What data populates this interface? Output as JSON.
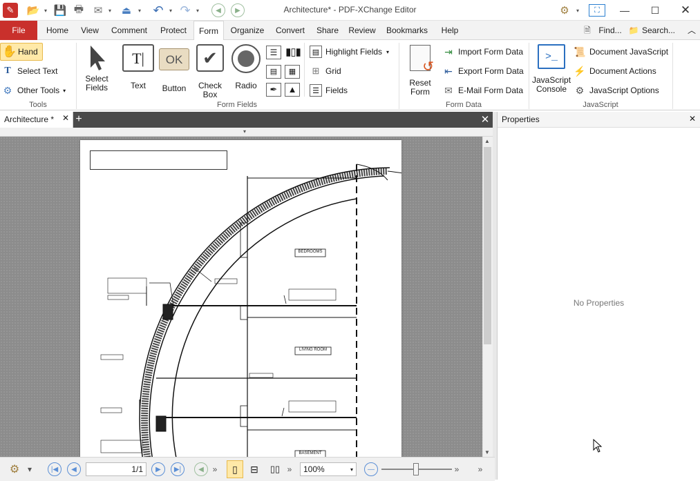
{
  "window": {
    "title": "Architecture* - PDF-XChange Editor"
  },
  "menubar": {
    "items": [
      "File",
      "Home",
      "View",
      "Comment",
      "Protect",
      "Form",
      "Organize",
      "Convert",
      "Share",
      "Review",
      "Bookmarks",
      "Help"
    ],
    "active": "Form",
    "find_label": "Find...",
    "search_label": "Search..."
  },
  "ribbon": {
    "tools": {
      "hand": "Hand",
      "select_text": "Select Text",
      "other_tools": "Other Tools",
      "group": "Tools"
    },
    "form_fields": {
      "select_fields": "Select Fields",
      "text": "Text",
      "button": "Button",
      "button_icon_text": "OK",
      "check_box": "Check Box",
      "radio": "Radio",
      "highlight_fields": "Highlight Fields",
      "grid": "Grid",
      "fields": "Fields",
      "group": "Form Fields"
    },
    "form_data": {
      "reset_form": "Reset Form",
      "import": "Import Form Data",
      "export": "Export Form Data",
      "email": "E-Mail Form Data",
      "group": "Form Data"
    },
    "javascript": {
      "console": "JavaScript Console",
      "document_js": "Document JavaScript",
      "document_actions": "Document Actions",
      "js_options": "JavaScript Options",
      "group": "JavaScript"
    }
  },
  "doc_tab": {
    "label": "Architecture *"
  },
  "drawing": {
    "labels": [
      "BEDROOMS",
      "LIVING ROOM",
      "BASEMENT"
    ]
  },
  "properties": {
    "title": "Properties",
    "empty": "No Properties"
  },
  "statusbar": {
    "page": "1/1",
    "zoom": "100%"
  }
}
